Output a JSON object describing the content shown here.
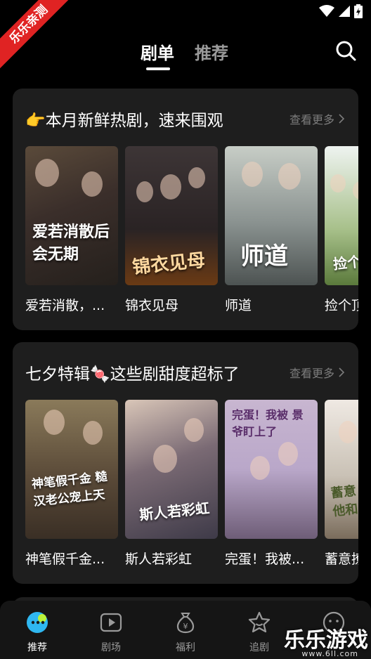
{
  "ribbon": "乐乐亲测",
  "header": {
    "tab_active": "剧单",
    "tab_inactive": "推荐"
  },
  "sections": [
    {
      "title": "👉本月新鲜热剧，速来围观",
      "more": "查看更多",
      "items": [
        {
          "title": "爱若消散，...",
          "poster_text": "爱若消散后会无期"
        },
        {
          "title": "锦衣见母",
          "poster_text": "锦衣见母"
        },
        {
          "title": "师道",
          "poster_text": "师道"
        },
        {
          "title": "捡个顶",
          "poster_text": "捡个男"
        }
      ]
    },
    {
      "title": "七夕特辑🍬这些剧甜度超标了",
      "more": "查看更多",
      "items": [
        {
          "title": "神笔假千金...",
          "poster_text": "神笔假千金 糙汉老公宠上天"
        },
        {
          "title": "斯人若彩虹",
          "poster_text": "斯人若彩虹"
        },
        {
          "title": "完蛋！我被...",
          "poster_text": "完蛋！我被 景爷盯上了"
        },
        {
          "title": "蓄意撩",
          "poster_text": "蓄意 他和"
        }
      ]
    }
  ],
  "tabbar": {
    "items": [
      {
        "label": "推荐",
        "icon": "recommend-icon"
      },
      {
        "label": "剧场",
        "icon": "play-icon"
      },
      {
        "label": "福利",
        "icon": "money-bag-icon"
      },
      {
        "label": "追剧",
        "icon": "star-icon"
      }
    ]
  },
  "watermark": {
    "main": "乐乐游戏",
    "sub": "www.6ll.com"
  },
  "colors": {
    "background": "#000000",
    "card": "#1e1e1e",
    "ribbon": "#e02323",
    "muted_text": "#7c7c7c"
  }
}
